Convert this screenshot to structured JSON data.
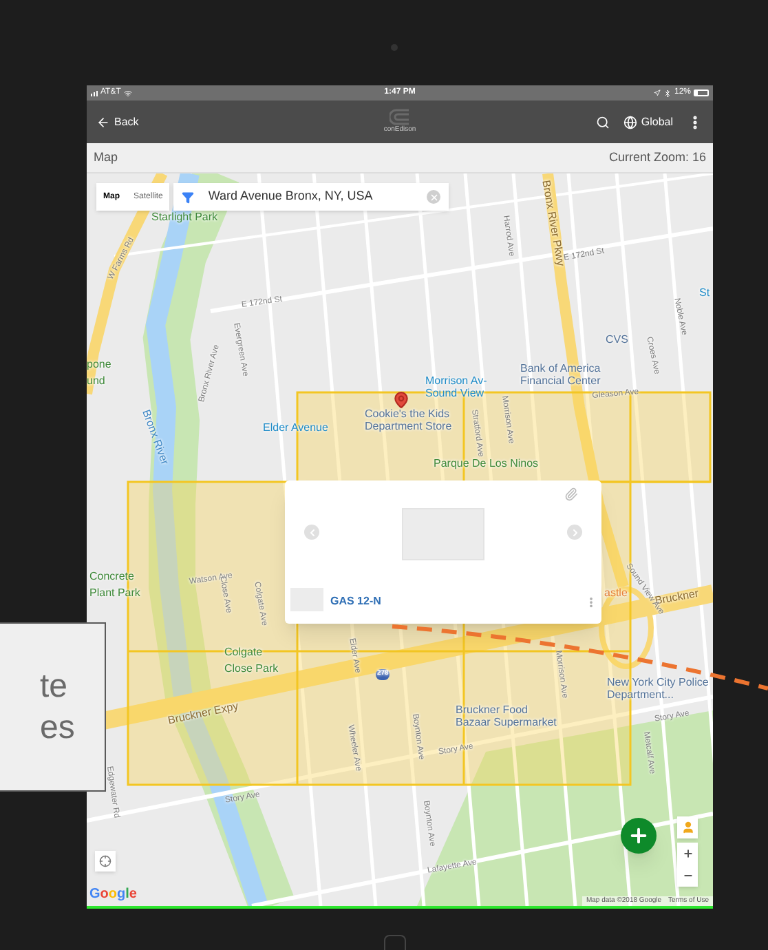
{
  "status_bar": {
    "carrier": "AT&T",
    "time": "1:47 PM",
    "battery": "12%"
  },
  "app_bar": {
    "back": "Back",
    "logo": "conEdison",
    "region": "Global"
  },
  "sub_bar": {
    "title": "Map",
    "zoom": "Current Zoom: 16"
  },
  "map_type_tabs": [
    {
      "label": "Map",
      "selected": true
    },
    {
      "label": "Satellite",
      "selected": false
    }
  ],
  "search": {
    "value": "Ward Avenue Bronx, NY, USA"
  },
  "map_labels": [
    {
      "text": "Starlight Park",
      "kind": "park"
    },
    {
      "text": "W Farms Rd",
      "kind": "street"
    },
    {
      "text": "E 172nd St",
      "kind": "street"
    },
    {
      "text": "E 172nd St",
      "kind": "street"
    },
    {
      "text": "Bronx River Pkwy",
      "kind": "road"
    },
    {
      "text": "Harrod Ave",
      "kind": "street"
    },
    {
      "text": "Evergreen Ave",
      "kind": "street"
    },
    {
      "text": "Bronx River",
      "kind": "water"
    },
    {
      "text": "Bronx River Ave",
      "kind": "street"
    },
    {
      "text": "CVS",
      "kind": "poi"
    },
    {
      "text": "Bank of America Financial Center",
      "kind": "poi"
    },
    {
      "text": "Morrison Av-Sound View",
      "kind": "transit"
    },
    {
      "text": "Elder Avenue",
      "kind": "transit"
    },
    {
      "text": "Cookie's the Kids Department Store",
      "kind": "poi"
    },
    {
      "text": "Parque De Los Ninos",
      "kind": "park"
    },
    {
      "text": "Gleason Ave",
      "kind": "street"
    },
    {
      "text": "Concrete Plant Park",
      "kind": "park"
    },
    {
      "text": "Watson Ave",
      "kind": "street"
    },
    {
      "text": "Colgate Close Park",
      "kind": "park"
    },
    {
      "text": "Bruckner Expy",
      "kind": "road"
    },
    {
      "text": "Bruckner",
      "kind": "road"
    },
    {
      "text": "New York City Police Department...",
      "kind": "poi"
    },
    {
      "text": "Bruckner Food Bazaar Supermarket",
      "kind": "poi"
    },
    {
      "text": "Story Ave",
      "kind": "street"
    },
    {
      "text": "Story Ave",
      "kind": "street"
    },
    {
      "text": "Story Ave",
      "kind": "street"
    },
    {
      "text": "Lafayette Ave",
      "kind": "street"
    },
    {
      "text": "astle",
      "kind": "food"
    },
    {
      "text": "Sound View Ave",
      "kind": "street"
    },
    {
      "text": "Edgewater Rd",
      "kind": "street"
    },
    {
      "text": "Metcalf Ave",
      "kind": "street"
    },
    {
      "text": "Noble Ave",
      "kind": "street"
    },
    {
      "text": "Croes Ave",
      "kind": "street"
    },
    {
      "text": "St",
      "kind": "transit"
    },
    {
      "text": "pone und",
      "kind": "park"
    },
    {
      "text": "Elder Ave",
      "kind": "street"
    },
    {
      "text": "Colgate Ave",
      "kind": "street"
    },
    {
      "text": "Close Ave",
      "kind": "street"
    },
    {
      "text": "Wheeler Ave",
      "kind": "street"
    },
    {
      "text": "Boynton Ave",
      "kind": "street"
    },
    {
      "text": "Boynton Ave",
      "kind": "street"
    },
    {
      "text": "Stratford Ave",
      "kind": "street"
    },
    {
      "text": "Morrison Ave",
      "kind": "street"
    },
    {
      "text": "Morrison Ave",
      "kind": "street"
    },
    {
      "text": "278",
      "kind": "shield"
    }
  ],
  "popup": {
    "title": "GAS 12-N"
  },
  "attribution": {
    "logo": "Google",
    "data": "Map data ©2018 Google",
    "terms": "Terms of Use"
  },
  "callout": {
    "lines": [
      "te",
      "es"
    ]
  }
}
